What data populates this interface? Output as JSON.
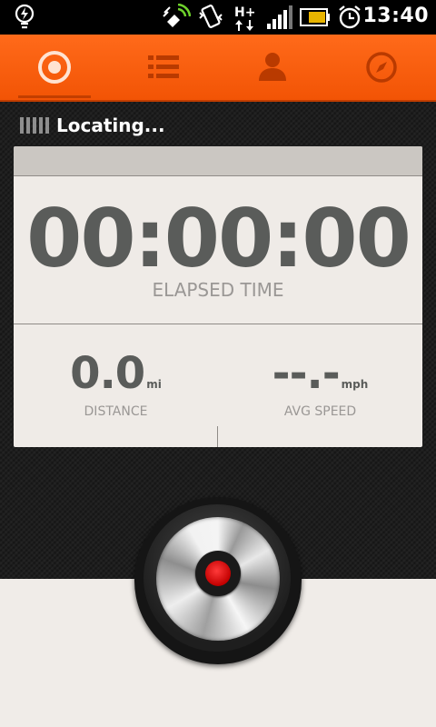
{
  "status_bar": {
    "time": "13:40",
    "network": "H+",
    "icons": [
      "lightbulb-icon",
      "gps-signal-icon",
      "vibrate-icon",
      "network-data-icon",
      "signal-strength-icon",
      "battery-icon",
      "alarm-clock-icon"
    ],
    "battery_level": 0.7,
    "signal_bars": 4
  },
  "tabs": [
    {
      "name": "record",
      "icon": "record-target-icon",
      "active": true
    },
    {
      "name": "activities-list",
      "icon": "list-icon",
      "active": false
    },
    {
      "name": "profile",
      "icon": "person-icon",
      "active": false
    },
    {
      "name": "explore",
      "icon": "compass-icon",
      "active": false
    }
  ],
  "locating": {
    "text": "Locating...",
    "bar_count": 5
  },
  "stats": {
    "elapsed_time": "00:00:00",
    "elapsed_label": "ELAPSED TIME",
    "distance_value": "0.0",
    "distance_unit": "mi",
    "distance_label": "DISTANCE",
    "speed_value": "--.-",
    "speed_unit": "mph",
    "speed_label": "AVG SPEED"
  },
  "colors": {
    "accent": "#f25405",
    "record_red": "#d90000",
    "card_bg": "#efebe7",
    "value_text": "#5a5c5a"
  }
}
